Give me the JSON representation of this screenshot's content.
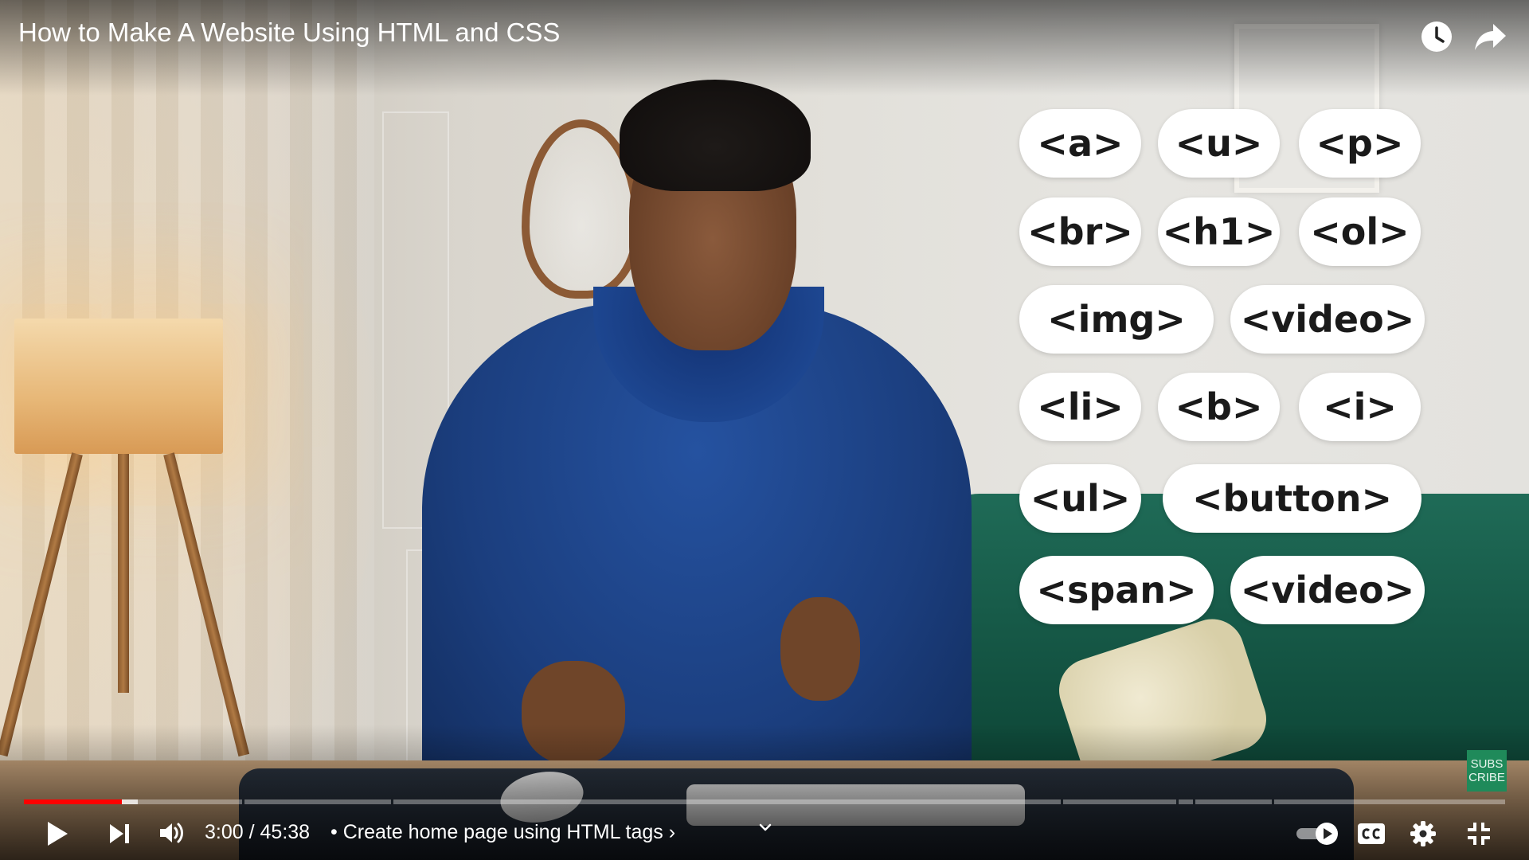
{
  "player": {
    "title": "How to Make A Website Using HTML and CSS",
    "current_time": "3:00",
    "duration": "45:38",
    "chapter": "• Create home page using HTML tags ›",
    "played_fraction": 0.066,
    "buffered_fraction": 0.077,
    "accent_color": "#ff0000"
  },
  "tags": [
    "<a>",
    "<u>",
    "<p>",
    "<br>",
    "<h1>",
    "<ol>",
    "<img>",
    "<video>",
    "<li>",
    "<b>",
    "<i>",
    "<ul>",
    "<button>",
    "<span>",
    "<video>"
  ],
  "watermark": {
    "line1": "SUBS",
    "line2": "CRIBE"
  },
  "icons": {
    "watch_later": "clock-icon",
    "share": "share-icon",
    "play": "play-icon",
    "next": "next-icon",
    "volume": "volume-icon",
    "autoplay": "autoplay-toggle-icon",
    "captions": "cc-icon",
    "settings": "gear-icon",
    "exit_fullscreen": "exit-fullscreen-icon",
    "chapter_expand": "chevron-down-icon"
  }
}
